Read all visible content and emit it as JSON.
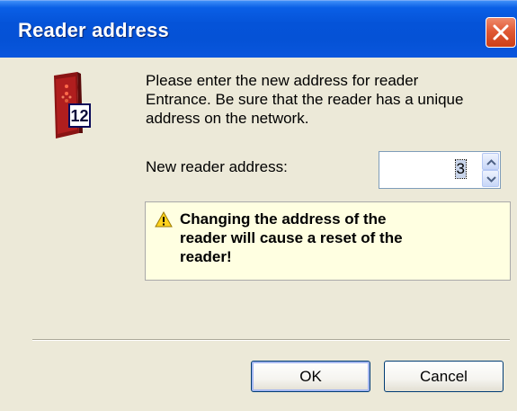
{
  "window": {
    "title": "Reader address",
    "close_icon": "close-icon"
  },
  "device": {
    "icon": "card-reader-icon",
    "number": "12"
  },
  "message": {
    "line1": "Please enter the new address for reader",
    "line2": "Entrance. Be sure that the reader has a unique",
    "line3": "address on the network."
  },
  "address_field": {
    "label": "New reader address:",
    "value": "3"
  },
  "warning": {
    "icon": "warning-icon",
    "line1": "Changing the address of the",
    "line2": "reader will cause a reset of the",
    "line3": "reader!"
  },
  "buttons": {
    "ok": "OK",
    "cancel": "Cancel"
  },
  "colors": {
    "titlebar": "#0553d8",
    "dialog_bg": "#ece9d8",
    "warning_bg": "#ffffe1",
    "close_button": "#e05a36"
  }
}
